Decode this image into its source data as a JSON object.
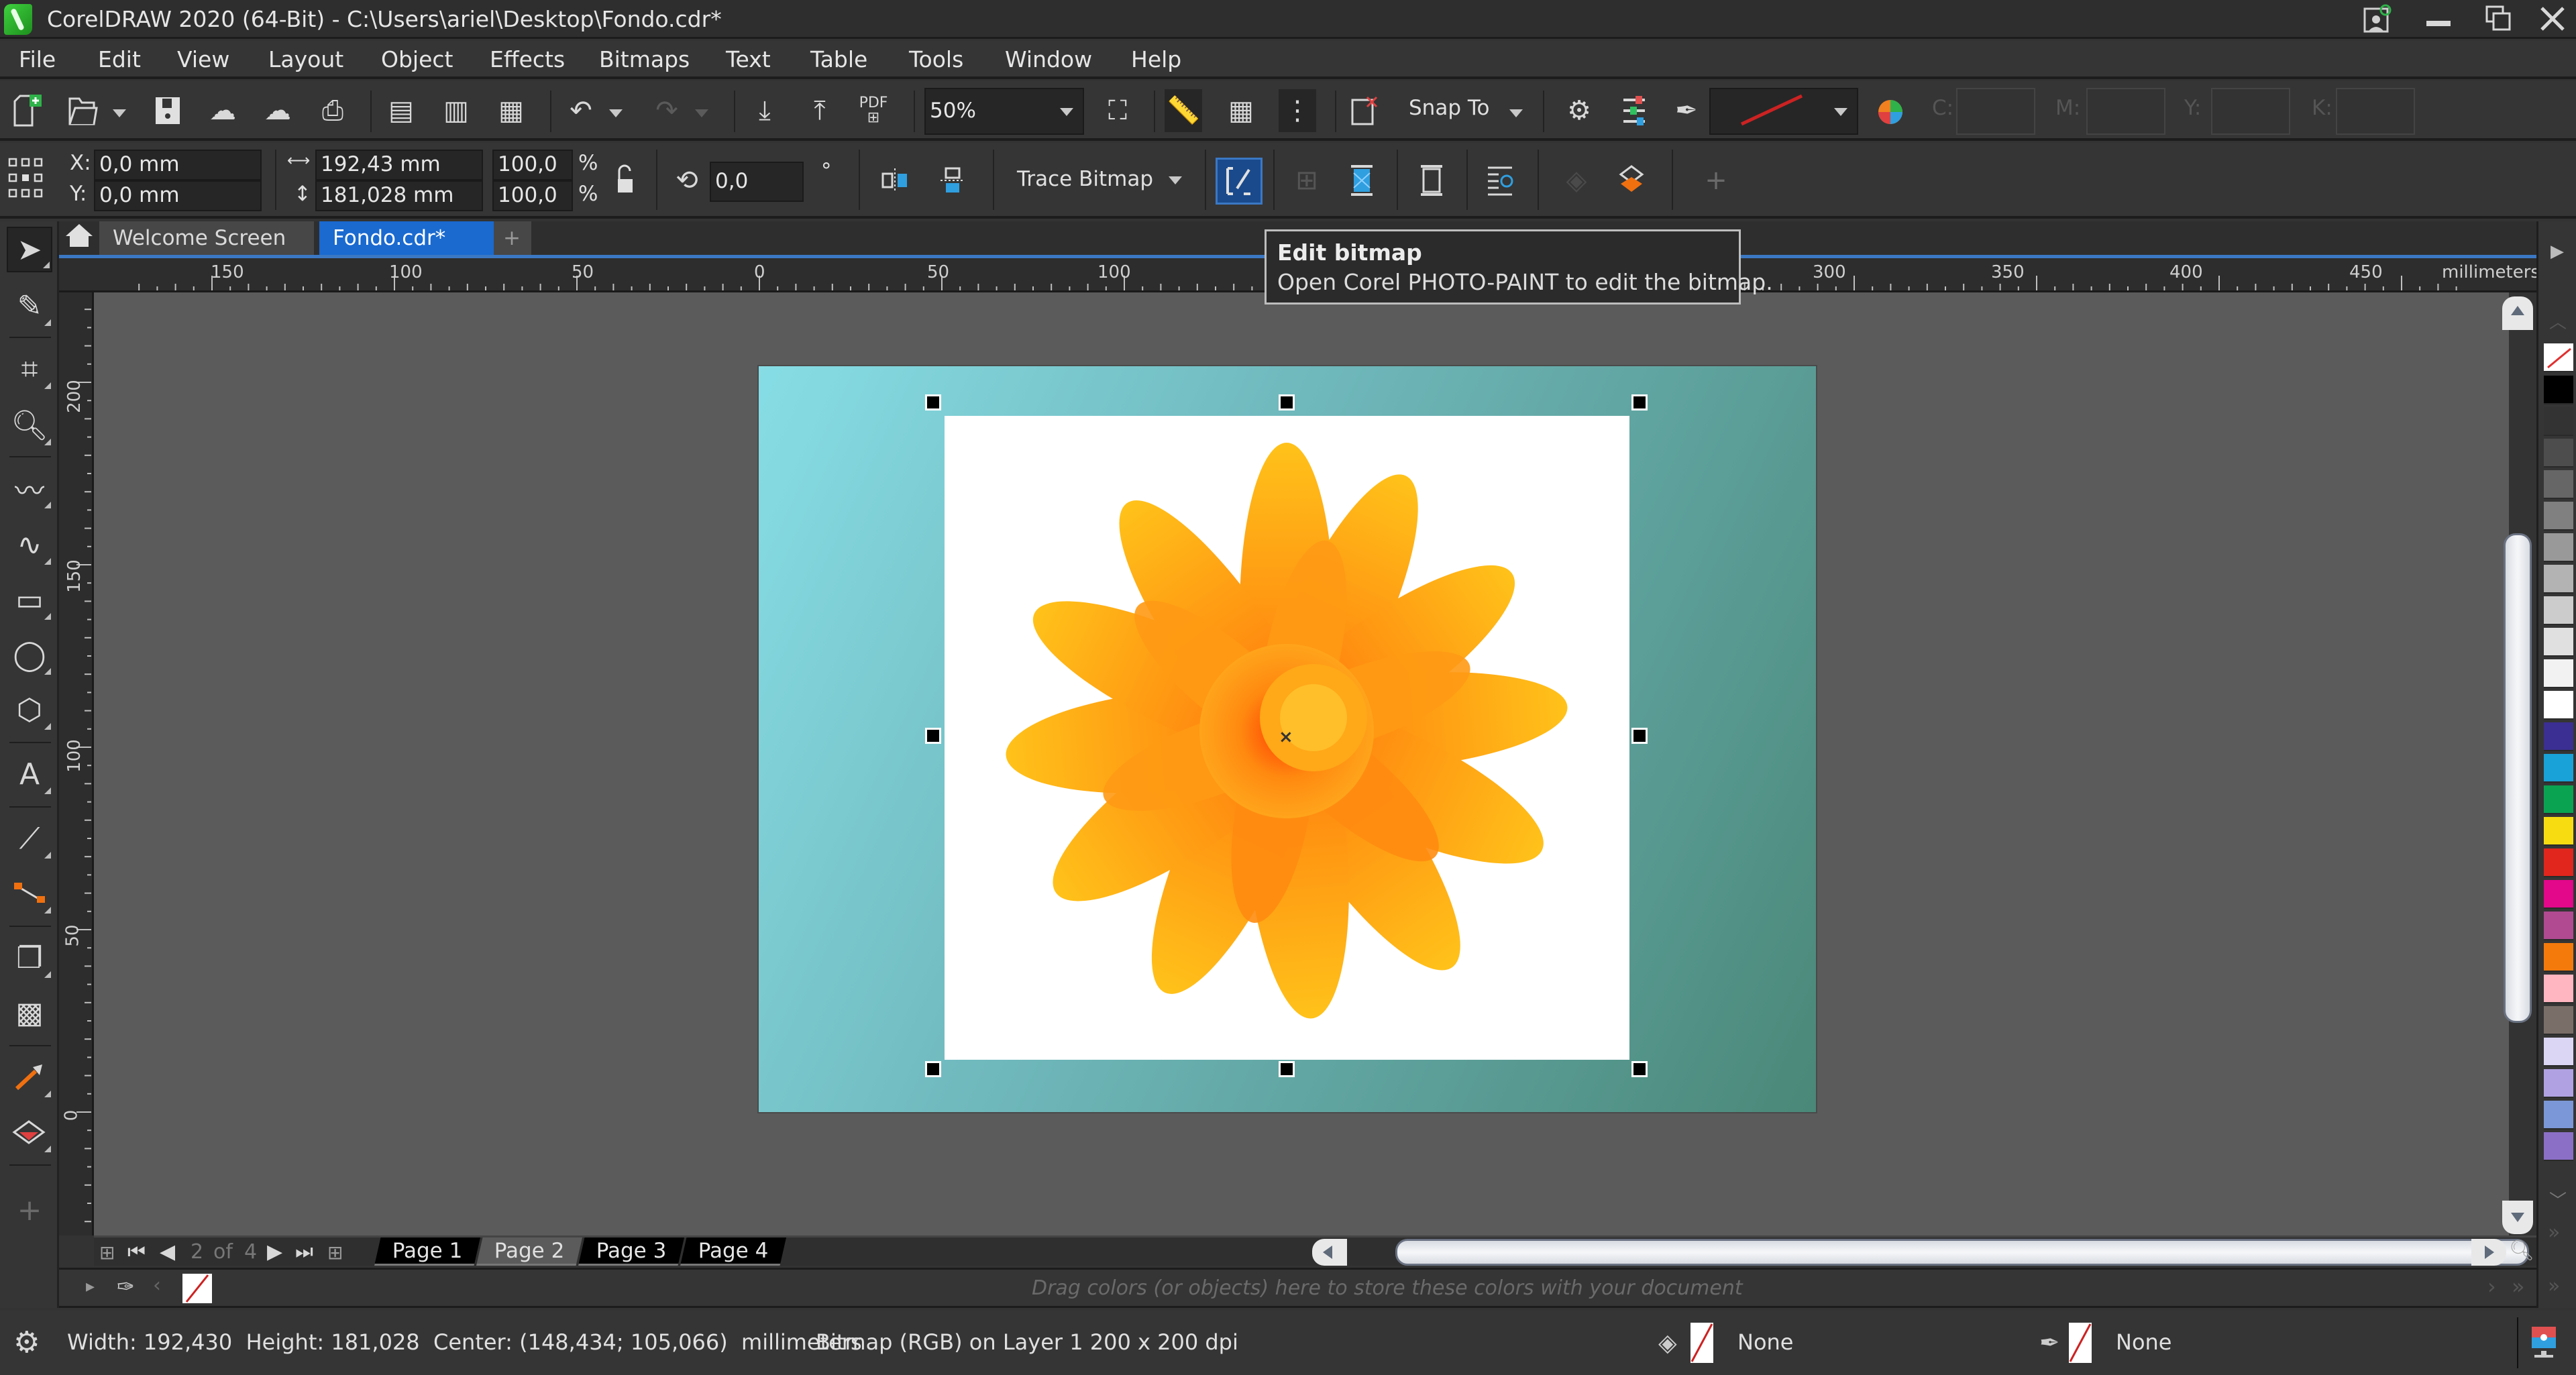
{
  "titlebar": {
    "title": "CorelDRAW 2020 (64-Bit) - C:\\Users\\ariel\\Desktop\\Fondo.cdr*",
    "controls": {
      "account": "account-icon",
      "minimize": "—",
      "restore": "❐",
      "close": "✕"
    }
  },
  "menubar": {
    "items": [
      {
        "label": "File",
        "accel": "F"
      },
      {
        "label": "Edit",
        "accel": "E"
      },
      {
        "label": "View",
        "accel": "V"
      },
      {
        "label": "Layout",
        "accel": "L"
      },
      {
        "label": "Object",
        "accel": "O"
      },
      {
        "label": "Effects",
        "accel": "c"
      },
      {
        "label": "Bitmaps",
        "accel": "B"
      },
      {
        "label": "Text",
        "accel": "x"
      },
      {
        "label": "Table",
        "accel": "T"
      },
      {
        "label": "Tools",
        "accel": "o"
      },
      {
        "label": "Window",
        "accel": "W"
      },
      {
        "label": "Help",
        "accel": "H"
      }
    ]
  },
  "toolbar": {
    "zoom_level": "50%",
    "snap_to_label": "Snap To",
    "pdf_label": "PDF",
    "cmyk_labels": [
      "C:",
      "M:",
      "Y:",
      "K:"
    ],
    "outline_color": "#cc2222"
  },
  "propbar": {
    "x_label": "X:",
    "x_value": "0,0 mm",
    "y_label": "Y:",
    "y_value": "0,0 mm",
    "width_value": "192,43 mm",
    "height_value": "181,028 mm",
    "scale_x": "100,0",
    "scale_y": "100,0",
    "percent": "%",
    "rotation": "0,0",
    "degree_symbol": "°",
    "trace_bitmap_label": "Trace Bitmap"
  },
  "doctabs": {
    "tabs": [
      {
        "label": "Welcome Screen",
        "active": false
      },
      {
        "label": "Fondo.cdr*",
        "active": true
      }
    ],
    "add_label": "+"
  },
  "tooltip": {
    "title": "Edit bitmap",
    "description": "Open Corel PHOTO-PAINT to edit the bitmap."
  },
  "hruler": {
    "labels": [
      "150",
      "100",
      "50",
      "0",
      "50",
      "100",
      "300",
      "350",
      "400",
      "450"
    ],
    "units": "millimeters"
  },
  "vruler": {
    "labels": [
      "200",
      "150",
      "100",
      "50",
      "0"
    ]
  },
  "pagenav": {
    "current": "2",
    "of_label": "of",
    "total": "4",
    "pages": [
      "Page 1",
      "Page 2",
      "Page 3",
      "Page 4"
    ],
    "active_page": 1
  },
  "docpalette": {
    "hint": "Drag colors (or objects) here to store these colors with your document"
  },
  "statusbar": {
    "dimensions": "Width: 192,430  Height: 181,028  Center: (148,434; 105,066)  millimeters",
    "object_info": "Bitmap (RGB) on Layer 1 200 x 200 dpi",
    "fill_label": "None",
    "outline_label": "None"
  },
  "palette": {
    "colors": [
      "#000000",
      "#333333",
      "#4d4d4d",
      "#666666",
      "#808080",
      "#999999",
      "#b3b3b3",
      "#cccccc",
      "#e0e0e0",
      "#f2f2f2",
      "#ffffff",
      "#3b2f93",
      "#19a2d8",
      "#0aa352",
      "#f7dc12",
      "#e0261d",
      "#e3078a",
      "#b14a91",
      "#f47a0c",
      "#ffb6c1",
      "#7a6e68",
      "#dcd6f5",
      "#b0a2e2",
      "#7b97d7",
      "#8b6fc6"
    ]
  },
  "canvas": {
    "page_gradient": [
      "#87dde5",
      "#4a8878"
    ],
    "bitmap_description": "Orange dahlia flower on white background"
  }
}
